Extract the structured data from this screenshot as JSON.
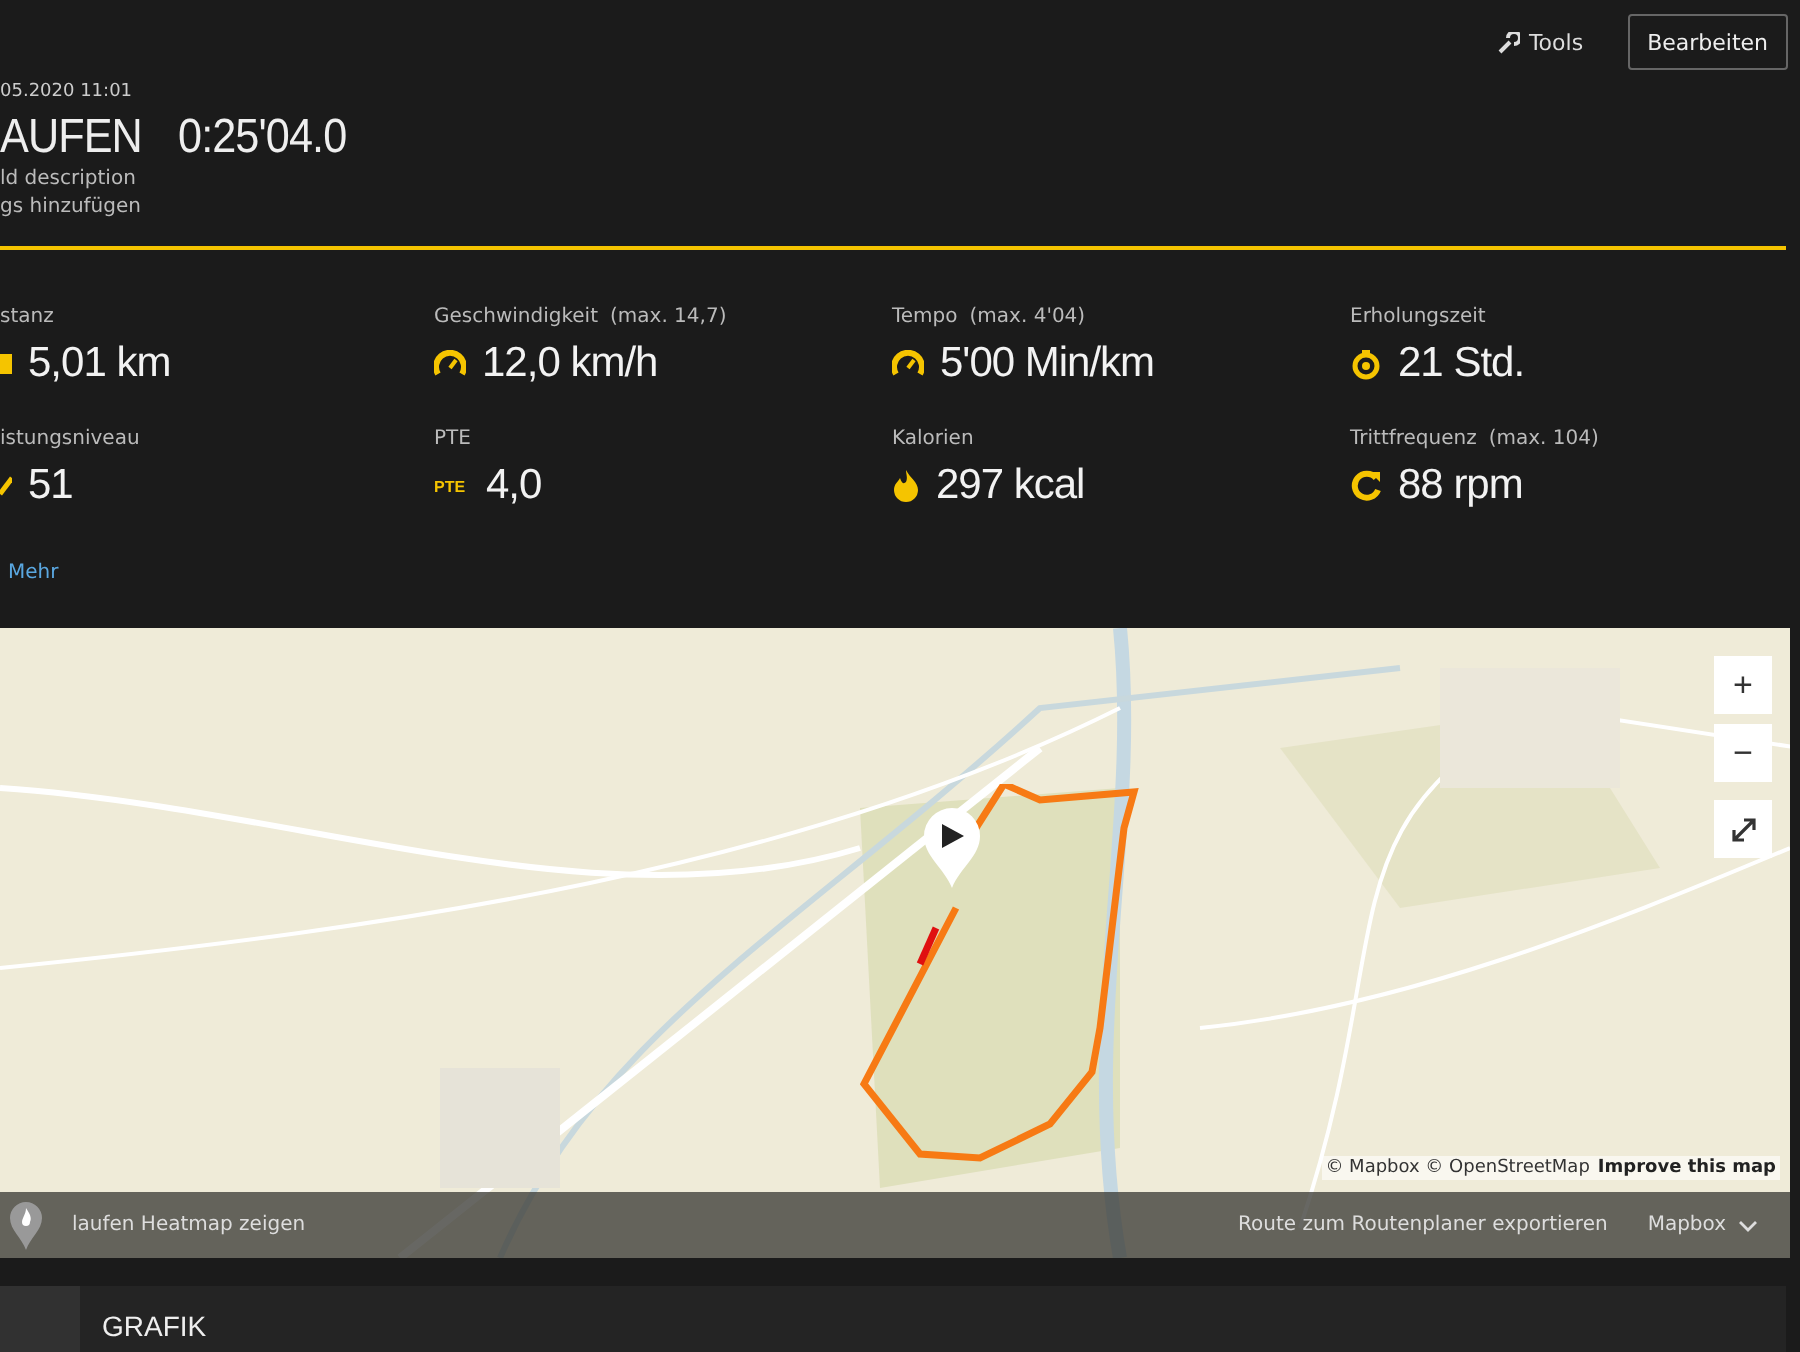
{
  "header": {
    "tools_label": "Tools",
    "edit_button": "Bearbeiten",
    "date": "05.2020 11:01",
    "sport": "AUFEN",
    "duration": "0:25'04.0",
    "description_link": "ld description",
    "tags_link": "gs hinzufügen"
  },
  "stats": [
    {
      "label": "stanz",
      "value": "5,01 km"
    },
    {
      "label": "Geschwindigkeit",
      "max": "(max.  14,7)",
      "value": "12,0 km/h"
    },
    {
      "label": "Tempo",
      "max": "(max.  4'04)",
      "value": "5'00 Min/km"
    },
    {
      "label": "Erholungszeit",
      "value": "21 Std."
    },
    {
      "label": "istungsniveau",
      "value": "51"
    },
    {
      "label": "PTE",
      "badge": "PTE",
      "value": "4,0"
    },
    {
      "label": "Kalorien",
      "value": "297 kcal"
    },
    {
      "label": "Trittfrequenz",
      "max": "(max.  104)",
      "value": "88 rpm"
    }
  ],
  "more_link": "Mehr",
  "map": {
    "kind": "picture",
    "zoom_in": "+",
    "zoom_out": "−",
    "attribution": "© Mapbox © OpenStreetMap",
    "improve_link": "Improve this map",
    "heatmap_label": "laufen Heatmap zeigen",
    "export_link": "Route zum Routenplaner exportieren",
    "style_select": "Mapbox"
  },
  "section": {
    "title": "GRAFIK"
  }
}
